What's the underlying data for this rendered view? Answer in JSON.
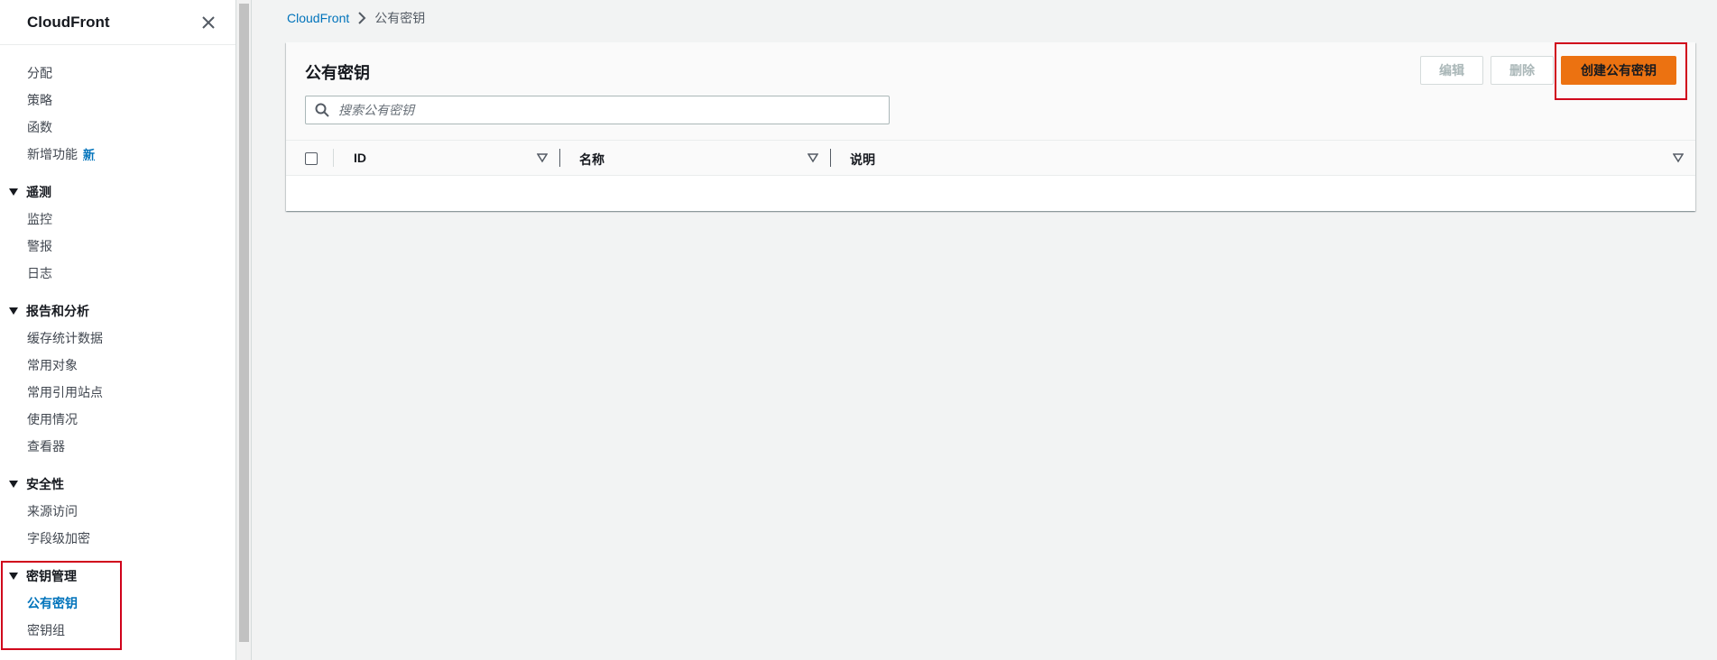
{
  "sidebar": {
    "title": "CloudFront",
    "top_items": [
      {
        "label": "分配"
      },
      {
        "label": "策略"
      },
      {
        "label": "函数"
      },
      {
        "label": "新增功能",
        "badge": "新"
      }
    ],
    "sections": [
      {
        "label": "遥测",
        "items": [
          "监控",
          "警报",
          "日志"
        ]
      },
      {
        "label": "报告和分析",
        "items": [
          "缓存统计数据",
          "常用对象",
          "常用引用站点",
          "使用情况",
          "查看器"
        ]
      },
      {
        "label": "安全性",
        "items": [
          "来源访问",
          "字段级加密"
        ]
      },
      {
        "label": "密钥管理",
        "items": [
          "公有密钥",
          "密钥组"
        ],
        "active_item": "公有密钥"
      }
    ]
  },
  "breadcrumb": {
    "root": "CloudFront",
    "current": "公有密钥"
  },
  "panel": {
    "title": "公有密钥",
    "edit_label": "编辑",
    "delete_label": "删除",
    "create_label": "创建公有密钥",
    "search_placeholder": "搜索公有密钥"
  },
  "table": {
    "columns": [
      "ID",
      "名称",
      "说明"
    ]
  },
  "colors": {
    "link": "#0073bb",
    "primary_button": "#ec7211",
    "highlight": "#d0021b"
  }
}
